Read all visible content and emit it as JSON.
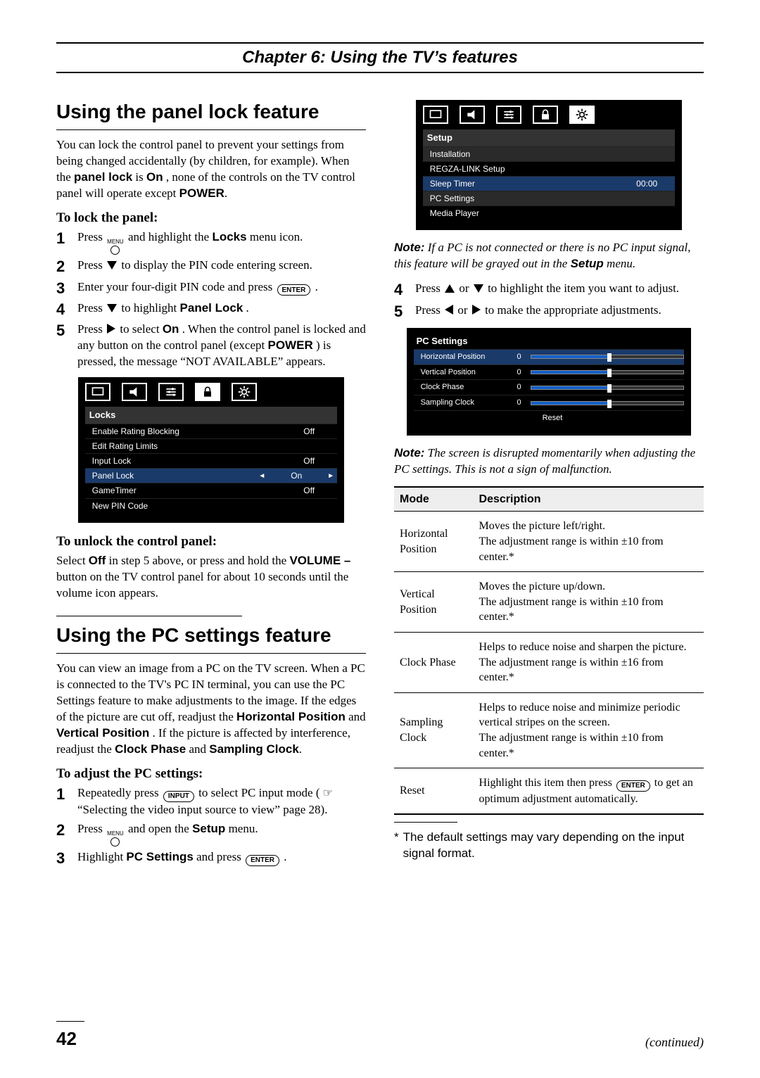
{
  "chapter": "Chapter 6: Using the TV’s features",
  "page_number": "42",
  "continued": "(continued)",
  "left": {
    "h_panel_lock": "Using the panel lock feature",
    "p_intro": [
      "You can lock the control panel to prevent your settings from being changed accidentally (by children, for example). When the ",
      "panel lock",
      " is ",
      "On",
      ", none of the controls on the TV control panel will operate except ",
      "POWER",
      "."
    ],
    "sub_lock": "To lock the panel:",
    "steps_lock": [
      {
        "n": "1",
        "pre": "Press ",
        "menu": "MENU",
        "post": " and highlight the ",
        "bold": "Locks",
        "tail": " menu icon."
      },
      {
        "n": "2",
        "pre": "Press ",
        "arrow": "down",
        "post": " to display the PIN code entering screen."
      },
      {
        "n": "3",
        "pre": "Enter your four-digit PIN code and press ",
        "pill": "ENTER",
        "tail": "."
      },
      {
        "n": "4",
        "pre": "Press ",
        "arrow": "down",
        "mid": " to highlight ",
        "bold": "Panel Lock",
        "tail": "."
      },
      {
        "n": "5",
        "pre": "Press ",
        "arrow": "right",
        "mid": " to select ",
        "bold": "On",
        "post": ". When the control panel is locked and any button on the control panel (except ",
        "bold2": "POWER",
        "tail": ") is pressed, the message “NOT AVAILABLE” appears."
      }
    ],
    "osd_locks": {
      "title": "Locks",
      "rows": [
        {
          "label": "Enable Rating Blocking",
          "value": "Off"
        },
        {
          "label": "Edit Rating Limits",
          "value": ""
        },
        {
          "label": "Input Lock",
          "value": "Off"
        },
        {
          "label": "Panel Lock",
          "value": "On",
          "active": true,
          "arrows": true
        },
        {
          "label": "GameTimer",
          "value": "Off"
        },
        {
          "label": "New PIN Code",
          "value": ""
        }
      ]
    },
    "sub_unlock": "To unlock the control panel:",
    "p_unlock": [
      "Select ",
      "Off",
      " in step 5 above, or press and hold the ",
      "VOLUME –",
      " button on the TV control panel for about 10 seconds until the volume icon appears."
    ],
    "h_pc": "Using the PC settings feature",
    "p_pc": [
      "You can view an image from a PC on the TV screen. When a PC is connected to the TV's PC IN terminal, you can use the PC Settings feature to make adjustments to the image. If the edges of the picture are cut off, readjust the ",
      "Horizontal Position",
      " and ",
      "Vertical Position",
      ". If the picture is affected by interference, readjust the ",
      "Clock Phase",
      " and ",
      "Sampling Clock",
      "."
    ],
    "sub_adjust": "To adjust the PC settings:",
    "steps_adjust": [
      {
        "n": "1",
        "pre": "Repeatedly press ",
        "pill": "INPUT",
        "mid": " to select PC input mode (",
        "hand": "☞",
        "post": " “Selecting the video input source to view” page 28)."
      },
      {
        "n": "2",
        "pre": "Press ",
        "menu": "MENU",
        "mid": " and open the ",
        "bold": "Setup",
        "tail": " menu."
      },
      {
        "n": "3",
        "pre": "Highlight ",
        "bold": "PC Settings",
        "mid": " and press ",
        "pill": "ENTER",
        "tail": "."
      }
    ]
  },
  "right": {
    "osd_setup": {
      "title": "Setup",
      "rows": [
        {
          "label": "Installation",
          "value": "",
          "shade": true
        },
        {
          "label": "REGZA-LINK Setup",
          "value": ""
        },
        {
          "label": "Sleep Timer",
          "value": "00:00",
          "active": true
        },
        {
          "label": "PC Settings",
          "value": "",
          "shade": true
        },
        {
          "label": "Media Player",
          "value": ""
        }
      ]
    },
    "note1": [
      "Note:",
      " If a PC is not connected or there is no PC input signal, this feature will be grayed out in the ",
      "Setup",
      " menu."
    ],
    "steps_cont": [
      {
        "n": "4",
        "pre": "Press ",
        "arrow1": "up",
        "or": " or ",
        "arrow2": "down",
        "post": " to highlight the item you want to adjust."
      },
      {
        "n": "5",
        "pre": "Press ",
        "arrow1": "left",
        "or": " or ",
        "arrow2": "right",
        "post": " to make the appropriate adjustments."
      }
    ],
    "osd_pc": {
      "title": "PC Settings",
      "rows": [
        {
          "label": "Horizontal Position",
          "value": "0",
          "active": true
        },
        {
          "label": "Vertical Position",
          "value": "0"
        },
        {
          "label": "Clock Phase",
          "value": "0"
        },
        {
          "label": "Sampling Clock",
          "value": "0"
        }
      ],
      "reset": "Reset"
    },
    "note2": [
      "Note:",
      " The screen is disrupted momentarily when adjusting the PC settings. This is not a sign of malfunction."
    ],
    "table": {
      "head": [
        "Mode",
        "Description"
      ],
      "rows": [
        {
          "mode": "Horizontal Position",
          "desc": "Moves the picture left/right.\nThe adjustment range is within ±10 from center.*"
        },
        {
          "mode": "Vertical Position",
          "desc": "Moves the picture up/down.\nThe adjustment range is within ±10 from center.*"
        },
        {
          "mode": "Clock Phase",
          "desc": "Helps to reduce noise and sharpen the picture.\nThe adjustment range is within ±16 from center.*"
        },
        {
          "mode": "Sampling Clock",
          "desc": "Helps to reduce noise and minimize periodic vertical stripes on the screen.\nThe adjustment range is within ±10 from center.*"
        },
        {
          "mode": "Reset",
          "desc_pre": "Highlight this item then press ",
          "pill": "ENTER",
          "desc_post": " to get an optimum adjustment automatically."
        }
      ]
    },
    "footnote": [
      "*",
      "The default settings may vary depending on the input signal format."
    ]
  }
}
